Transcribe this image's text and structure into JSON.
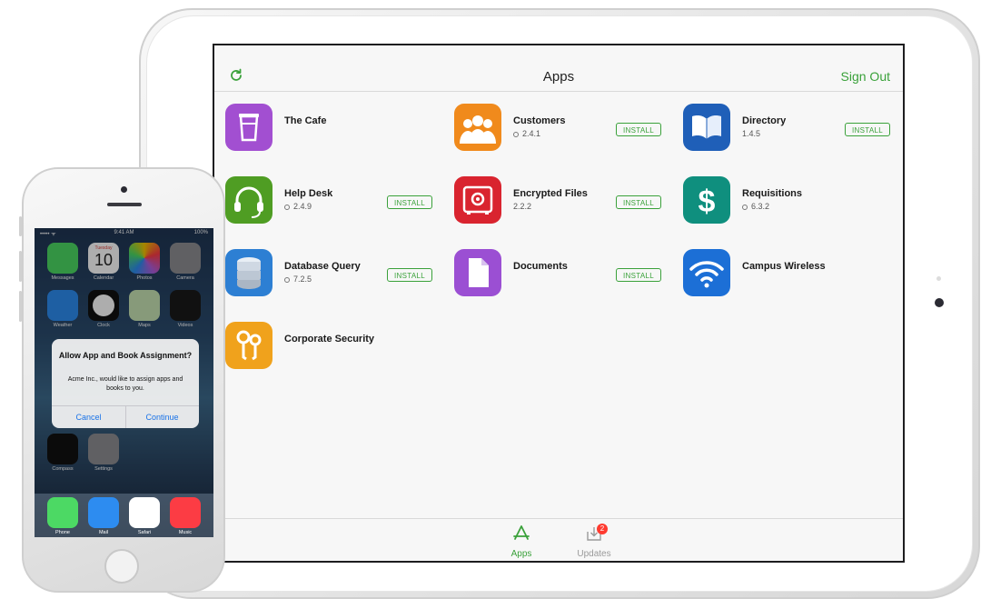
{
  "ipad": {
    "nav": {
      "title": "Apps",
      "sign_out": "Sign Out",
      "refresh_icon": "refresh-icon"
    },
    "apps": [
      {
        "name": "The Cafe",
        "version": "",
        "install": false,
        "icon": "cup-icon",
        "color": "#a24fd1"
      },
      {
        "name": "Customers",
        "version": "2.4.1",
        "install": true,
        "icon": "people-icon",
        "color": "#f08a1c"
      },
      {
        "name": "Directory",
        "version": "1.4.5",
        "install": true,
        "icon": "book-icon",
        "color": "#1f5fb8"
      },
      {
        "name": "Help Desk",
        "version": "2.4.9",
        "install": true,
        "icon": "headset-icon",
        "color": "#4f9d23"
      },
      {
        "name": "Encrypted Files",
        "version": "2.2.2",
        "install": true,
        "icon": "safe-icon",
        "color": "#d9242f"
      },
      {
        "name": "Requisitions",
        "version": "6.3.2",
        "install": false,
        "icon": "dollar-icon",
        "color": "#0f8f7e"
      },
      {
        "name": "Database Query",
        "version": "7.2.5",
        "install": true,
        "icon": "database-icon",
        "color": "#2d7fd3"
      },
      {
        "name": "Documents",
        "version": "",
        "install": true,
        "icon": "document-icon",
        "color": "#9b4fd3"
      },
      {
        "name": "Campus Wireless",
        "version": "",
        "install": false,
        "icon": "wifi-icon",
        "color": "#1c6fd6"
      },
      {
        "name": "Corporate Security",
        "version": "",
        "install": false,
        "icon": "keys-icon",
        "color": "#f0a21c"
      }
    ],
    "install_label": "INSTALL",
    "tabs": [
      {
        "label": "Apps",
        "active": true,
        "icon": "app-store-icon"
      },
      {
        "label": "Updates",
        "active": false,
        "icon": "download-tray-icon",
        "badge": "2"
      }
    ],
    "accent_color": "#3aa13a"
  },
  "iphone": {
    "status": {
      "carrier": "••••• ᯤ",
      "time": "9:41 AM",
      "battery": "100%"
    },
    "date_day": "Tuesday",
    "date_num": "10",
    "home_icons": [
      {
        "label": "Messages",
        "icon": "messages-icon",
        "color": "#4cd964"
      },
      {
        "label": "Calendar",
        "icon": "calendar-icon",
        "color": "#ffffff"
      },
      {
        "label": "Photos",
        "icon": "photos-icon",
        "color": "#ffffff"
      },
      {
        "label": "Camera",
        "icon": "camera-icon",
        "color": "#8e8e93"
      },
      {
        "label": "Weather",
        "icon": "weather-icon",
        "color": "#2d8cf0"
      },
      {
        "label": "Clock",
        "icon": "clock-icon",
        "color": "#111111"
      },
      {
        "label": "Maps",
        "icon": "maps-icon",
        "color": "#c7e3b4"
      },
      {
        "label": "Videos",
        "icon": "videos-icon",
        "color": "#1a1a1a"
      },
      {
        "label": "Compass",
        "icon": "compass-icon",
        "color": "#111111"
      },
      {
        "label": "Settings",
        "icon": "settings-icon",
        "color": "#8e8e93"
      }
    ],
    "dock": [
      {
        "label": "Phone",
        "icon": "phone-icon",
        "color": "#4cd964"
      },
      {
        "label": "Mail",
        "icon": "mail-icon",
        "color": "#2d8cf0"
      },
      {
        "label": "Safari",
        "icon": "safari-icon",
        "color": "#ffffff"
      },
      {
        "label": "Music",
        "icon": "music-icon",
        "color": "#fc3c44"
      }
    ],
    "alert": {
      "title": "Allow App and Book Assignment?",
      "message": "Acme Inc., would like to assign apps and books to you.",
      "cancel": "Cancel",
      "confirm": "Continue"
    }
  }
}
